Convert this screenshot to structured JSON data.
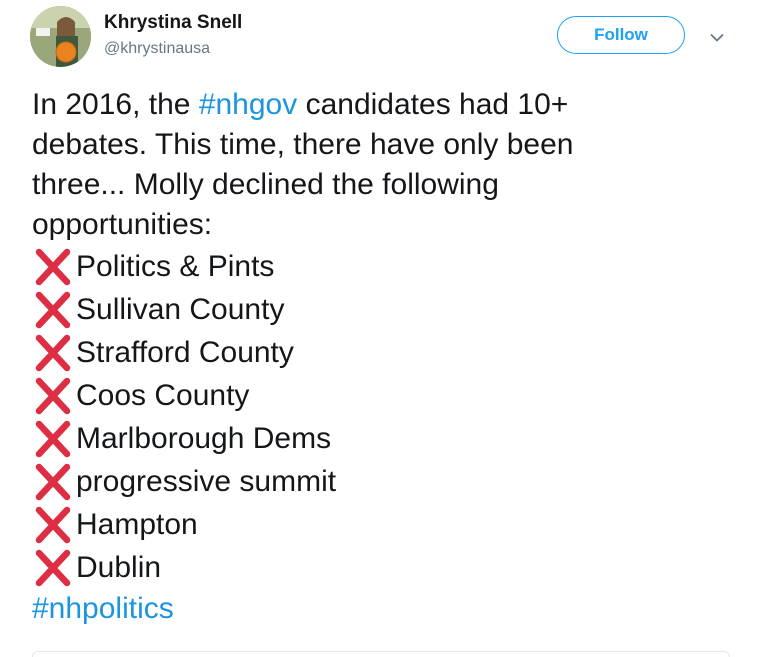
{
  "header": {
    "display_name": "Khrystina Snell",
    "handle": "@khrystinausa",
    "follow_label": "Follow",
    "avatar_icon": "user-avatar-photo",
    "menu_icon": "chevron-down-icon"
  },
  "tweet": {
    "intro_part1": "In 2016, the ",
    "intro_hashtag": "#nhgov",
    "intro_part2": " candidates had 10+",
    "line2": "debates. This time, there have only been",
    "line3": "three... Molly declined the following",
    "line4": "opportunities:",
    "declined": [
      "Politics & Pints",
      "Sullivan County",
      "Strafford County",
      "Coos County",
      "Marlborough Dems",
      "progressive summit",
      "Hampton",
      "Dublin"
    ],
    "closing_hashtag": "#nhpolitics",
    "list_icon": "cross-mark-icon"
  },
  "colors": {
    "link": "#1b95e0",
    "follow": "#1da1f2",
    "cross": "#dd2e44",
    "text": "#14171a",
    "muted": "#657786"
  }
}
